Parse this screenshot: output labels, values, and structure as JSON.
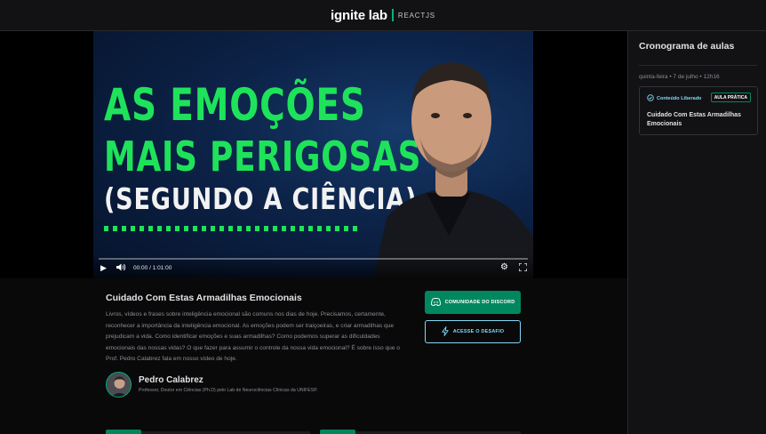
{
  "header": {
    "logo_main": "ignite lab",
    "logo_sub": "REACTJS"
  },
  "video": {
    "thumbnail_line1": "AS EMOÇÕES",
    "thumbnail_line2": "MAIS PERIGOSAS",
    "thumbnail_line3": "(SEGUNDO A CIÊNCIA)",
    "time": "00:00 / 1:01:00",
    "progress": 0
  },
  "lesson": {
    "title": "Cuidado Com Estas Armadilhas Emocionais",
    "description": "Livros, vídeos e frases sobre inteligência emocional são comuns nos dias de hoje. Precisamos, certamente, reconhecer a importância da inteligência emocional. As emoções podem ser traiçoeiras, e criar armadilhas que prejudicam a vida. Como identificar emoções e suas armadilhas? Como podemos superar as dificuldades emocionais das nossas vidas? O que fazer para assumir o controle da nossa vida emocional? É sobre isso que o Prof. Pedro Calabrez fala em nosso vídeo de hoje."
  },
  "teacher": {
    "name": "Pedro Calabrez",
    "bio": "Professor, Doutor em Ciências (Ph.D) pelo Lab de Neurociências Clínicas da UNIFESP."
  },
  "actions": {
    "discord_label": "COMUNIDADE DO DISCORD",
    "challenge_label": "ACESSE O DESAFIO"
  },
  "sidebar": {
    "title": "Cronograma de aulas",
    "lessons": [
      {
        "date": "quinta-feira • 7 de julho • 12h16",
        "status": "Conteúdo Liberado",
        "badge": "AULA PRÁTICA",
        "title": "Cuidado Com Estas Armadilhas Emocionais"
      }
    ]
  },
  "colors": {
    "accent_green": "#00875f",
    "accent_blue": "#81d8f7",
    "thumbnail_green": "#1ee35a"
  }
}
